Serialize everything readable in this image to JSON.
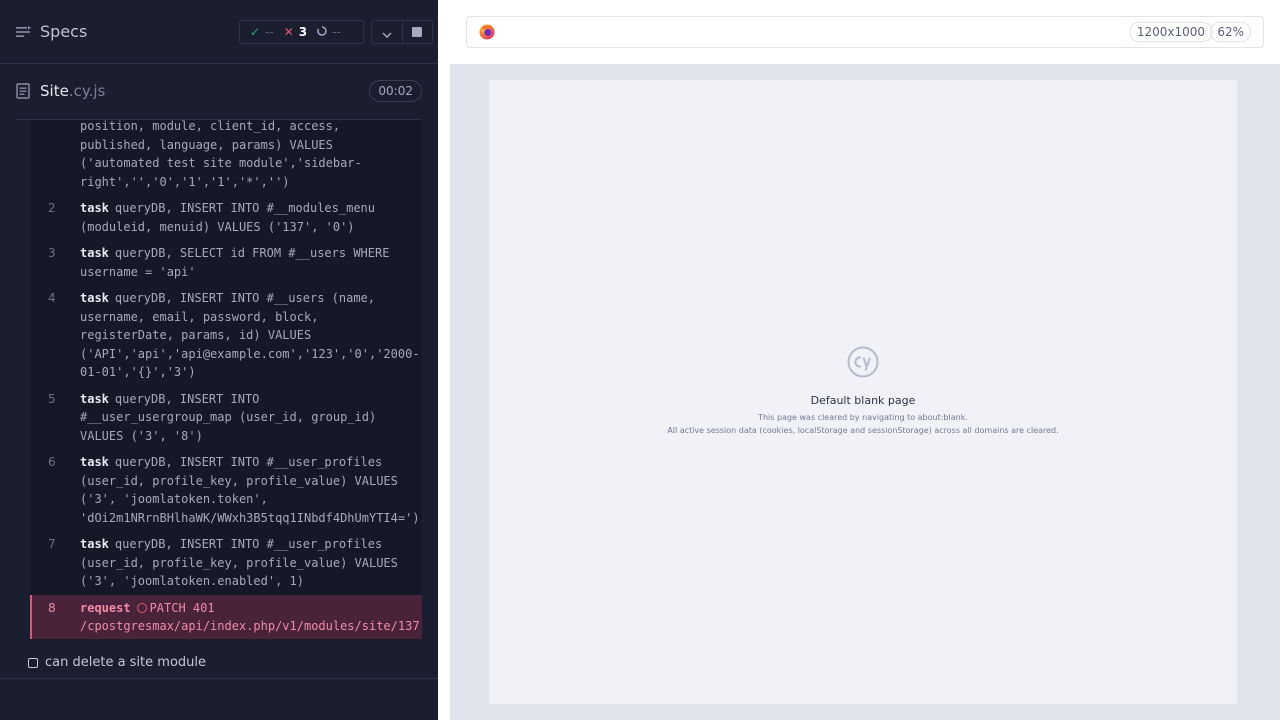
{
  "reporter": {
    "specs_label": "Specs",
    "stats": {
      "passed": "--",
      "failed": "3",
      "pending": "--"
    },
    "spec_file": {
      "name": "Site",
      "ext": ".cy.js",
      "duration": "00:02"
    },
    "commands": [
      {
        "number": "",
        "name": "",
        "message": "position, module, client_id, access, published, language, params) VALUES ('automated test site module','sidebar-right','','0','1','1','*','')"
      },
      {
        "number": "2",
        "name": "task",
        "message": "queryDB, INSERT INTO #__modules_menu (moduleid, menuid) VALUES ('137', '0')"
      },
      {
        "number": "3",
        "name": "task",
        "message": "queryDB, SELECT id FROM #__users WHERE username = 'api'"
      },
      {
        "number": "4",
        "name": "task",
        "message": "queryDB, INSERT INTO #__users (name, username, email, password, block, registerDate, params, id) VALUES ('API','api','api@example.com','123','0','2000-01-01','{}','3')"
      },
      {
        "number": "5",
        "name": "task",
        "message": "queryDB, INSERT INTO #__user_usergroup_map (user_id, group_id) VALUES ('3', '8')"
      },
      {
        "number": "6",
        "name": "task",
        "message": "queryDB, INSERT INTO #__user_profiles (user_id, profile_key, profile_value) VALUES ('3', 'joomlatoken.token', 'dOi2m1NRrnBHlhaWK/WWxh3B5tqq1INbdf4DhUmYTI4=')"
      },
      {
        "number": "7",
        "name": "task",
        "message": "queryDB, INSERT INTO #__user_profiles (user_id, profile_key, profile_value) VALUES ('3', 'joomlatoken.enabled', 1)"
      },
      {
        "number": "8",
        "name": "request",
        "message": "PATCH 401 /cpostgresmax/api/index.php/v1/modules/site/137",
        "state": "failed"
      }
    ],
    "test_title": "can delete a site module"
  },
  "aut": {
    "browser_icon": "firefox-icon",
    "viewport": "1200x1000",
    "zoom": "62%",
    "blank_page": {
      "title": "Default blank page",
      "line1": "This page was cleared by navigating to about:blank.",
      "line2": "All active session data (cookies, localStorage and sessionStorage) across all domains are cleared."
    }
  },
  "colors": {
    "reporter_bg": "#1b1e2e",
    "failed": "#e45770",
    "passed": "#1fa971",
    "aut_bg": "#e1e3ed"
  }
}
